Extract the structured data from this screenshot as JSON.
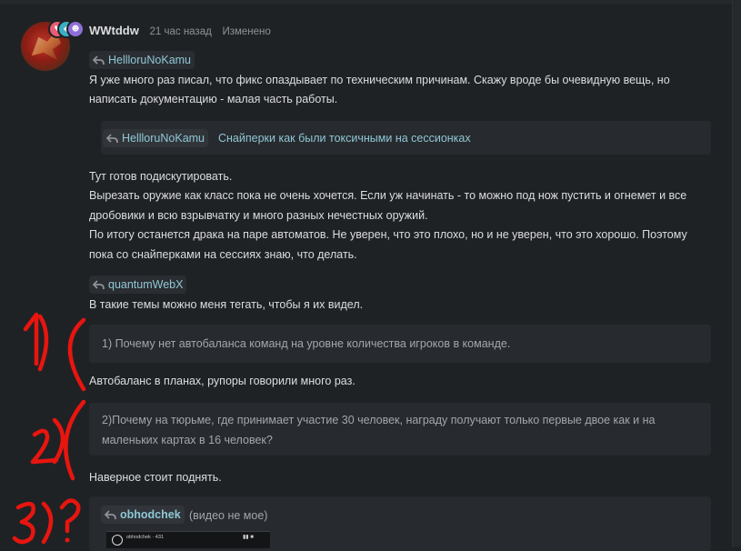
{
  "post": {
    "author": "WWtddw",
    "time": "21 час назад",
    "edited": "Изменено",
    "mention_hello": "HellloruNoKamu",
    "para1_line1": "Я уже много раз писал, что фикс опаздывает по техническим причинам. Скажу вроде бы очевидную вещь, но",
    "para1_line2": "написать документацию - малая часть работы.",
    "quote1_author": "HellloruNoKamu",
    "quote1_text": "Снайперки как были токсичными на сессионках",
    "para2_lines": [
      "Тут готов подискутировать.",
      "Вырезать оружие как класс пока не очень хочется. Если уж начинать - то можно под нож пустить и огнемет и все",
      "дробовики и всю взрывчатку и много разных нечестных оружий.",
      "По итогу останется драка на паре автоматов. Не уверен, что это плохо, но и не уверен, что это хорошо. Поэтому",
      "пока со снайперками на сессиях знаю, что делать."
    ],
    "mention_quantum": "quantumWebX",
    "para3": "В такие темы можно меня тегать, чтобы я их видел.",
    "quote2_text": "1) Почему нет автобаланса команд на уровне количества игроков в команде.",
    "para4": "Автобаланс в планах, рупоры говорили много раз.",
    "quote3_line1": "2)Почему на тюрьме, где принимает участие 30 человек, награду получают только первые двое как и на",
    "quote3_line2": "маленьких картах в 16 человек?",
    "para5": "Наверное стоит поднять.",
    "quote4_author": "obhodchek",
    "quote4_note": "(видео не мое)",
    "video_label": "obhodchek · 431"
  },
  "annotations": {
    "mark1": "1)",
    "mark2": "2)",
    "mark3": "3)?",
    "color": "#e8150f"
  },
  "colors": {
    "background": "#1f2225",
    "quote_bg": "#272a2e",
    "mention_text": "#8fc7d6",
    "badges": [
      "#e85d75",
      "#3ab0c4",
      "#8e6fd8"
    ]
  }
}
